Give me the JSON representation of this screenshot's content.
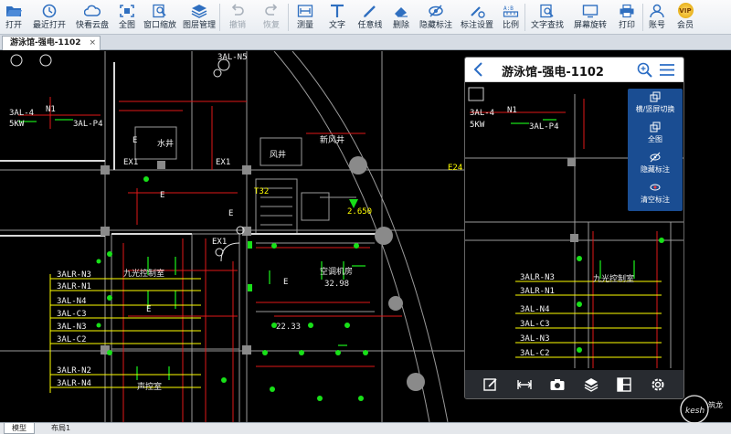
{
  "toolbar": {
    "buttons": [
      {
        "label": "打开",
        "icon": "folder-open-icon",
        "enabled": true
      },
      {
        "label": "最近打开",
        "icon": "clock-icon",
        "enabled": true
      },
      {
        "label": "快看云盘",
        "icon": "cloud-icon",
        "enabled": true
      },
      {
        "label": "全图",
        "icon": "fit-view-icon",
        "enabled": true
      },
      {
        "label": "窗口缩放",
        "icon": "zoom-window-icon",
        "enabled": true
      },
      {
        "label": "图层管理",
        "icon": "layers-icon",
        "enabled": true
      },
      {
        "label": "撤销",
        "icon": "undo-icon",
        "enabled": false
      },
      {
        "label": "恢复",
        "icon": "redo-icon",
        "enabled": false
      },
      {
        "label": "测量",
        "icon": "measure-icon",
        "enabled": true
      },
      {
        "label": "文字",
        "icon": "text-icon",
        "enabled": true
      },
      {
        "label": "任意线",
        "icon": "pen-icon",
        "enabled": true
      },
      {
        "label": "删除",
        "icon": "eraser-icon",
        "enabled": true
      },
      {
        "label": "隐藏标注",
        "icon": "eye-hide-icon",
        "enabled": true
      },
      {
        "label": "标注设置",
        "icon": "annotation-settings-icon",
        "enabled": true
      },
      {
        "label": "比例",
        "icon": "scale-icon",
        "enabled": true
      },
      {
        "label": "文字查找",
        "icon": "text-search-icon",
        "enabled": true
      },
      {
        "label": "屏幕旋转",
        "icon": "rotate-screen-icon",
        "enabled": true
      },
      {
        "label": "打印",
        "icon": "printer-icon",
        "enabled": true
      },
      {
        "label": "账号",
        "icon": "user-icon",
        "enabled": true
      },
      {
        "label": "会员",
        "icon": "vip-icon",
        "enabled": true
      }
    ],
    "vip_badge_text": "VIP"
  },
  "tab": {
    "title": "游泳馆-强电-1102",
    "close": "×"
  },
  "drawing": {
    "labels_white": [
      "3AL-4",
      "3AL-N5",
      "3AL-P4",
      "5KW",
      "N1",
      "水井",
      "风井",
      "新风井",
      "3ALR-N3",
      "3ALR-N1",
      "3AL-N4",
      "3AL-C3",
      "3AL-N3",
      "3AL-C2",
      "3ALR-N2",
      "3ALR-N4",
      "EX1",
      "EX1",
      "EX1",
      "E",
      "E",
      "E",
      "E",
      "E"
    ],
    "labels_room": [
      "九光控制室",
      "空调机房",
      "声控室",
      "32.98",
      "22.33"
    ],
    "labels_yellow": [
      "2.650",
      "T32",
      "E24"
    ]
  },
  "phone": {
    "title": "游泳馆-强电-1102",
    "menu": [
      {
        "label": "横/竖屏切换",
        "icon": "orientation-icon"
      },
      {
        "label": "全图",
        "icon": "fit-view-icon"
      },
      {
        "label": "隐藏标注",
        "icon": "eye-hide-icon"
      },
      {
        "label": "清空标注",
        "icon": "clear-annotation-icon"
      }
    ],
    "labels": [
      "3AL-4",
      "N1",
      "5KW",
      "3AL-P4",
      "3ALR-N3",
      "3ALR-N1",
      "3AL-N4",
      "3AL-C3",
      "3AL-N3",
      "3AL-C2",
      "九光控制室"
    ],
    "bottom_icons": [
      "edit-icon",
      "measure-icon",
      "camera-icon",
      "layers-icon",
      "layout-icon",
      "settings-icon"
    ]
  },
  "bottom_tabs": {
    "model": "模型",
    "layout": "布局1"
  },
  "watermark": "kesh 筑龙"
}
